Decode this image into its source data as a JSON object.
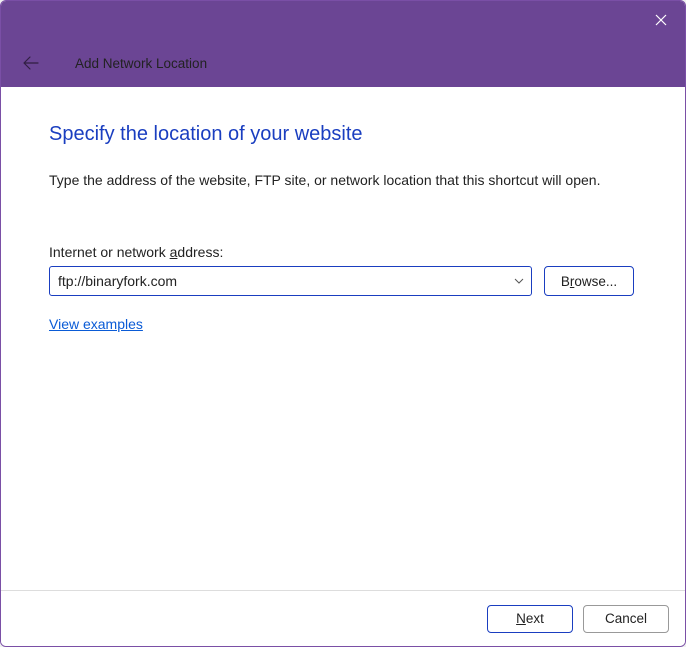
{
  "titlebar": {
    "wizard_title": "Add Network Location"
  },
  "page": {
    "title": "Specify the location of your website",
    "description": "Type the address of the website, FTP site, or network location that this shortcut will open."
  },
  "field": {
    "label_prefix": "Internet or network ",
    "label_mnemonic": "a",
    "label_suffix": "ddress:",
    "value": "ftp://binaryfork.com"
  },
  "browse": {
    "prefix": "B",
    "mnemonic": "r",
    "suffix": "owse..."
  },
  "link": {
    "view_examples": "View examples"
  },
  "footer": {
    "next_mnemonic": "N",
    "next_suffix": "ext",
    "cancel": "Cancel"
  }
}
